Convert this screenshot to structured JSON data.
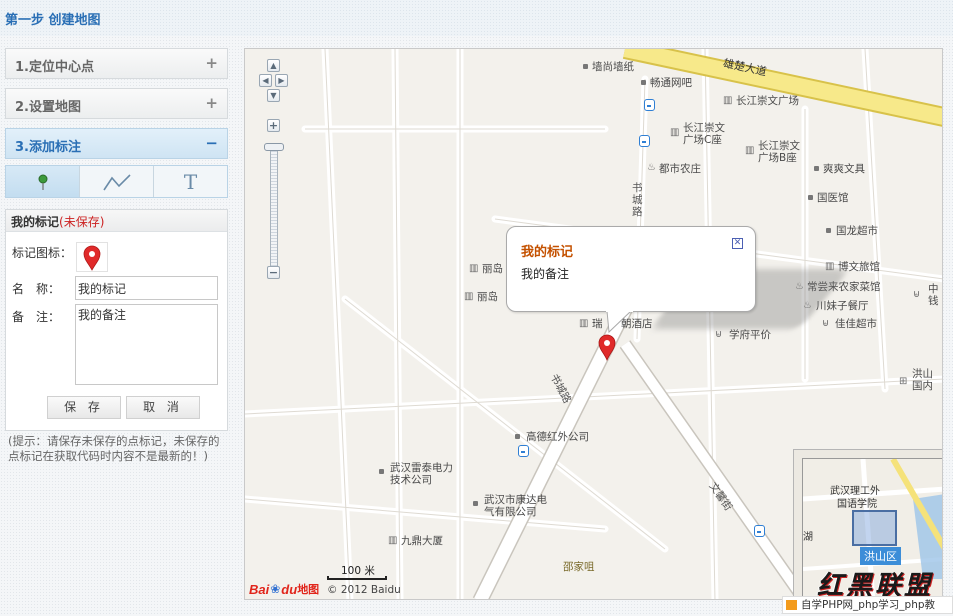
{
  "header": {
    "title": "第一步 创建地图"
  },
  "steps": [
    {
      "label": "1.定位中心点",
      "toggle": "+"
    },
    {
      "label": "2.设置地图",
      "toggle": "+"
    },
    {
      "label": "3.添加标注",
      "toggle": "−"
    }
  ],
  "tools": {
    "text_tool": "T",
    "icons": [
      "pin-icon",
      "polyline-icon",
      "text-icon"
    ]
  },
  "marker_panel": {
    "title": "我的标记",
    "unsaved": "(未保存)",
    "icon_label": "标记图标：",
    "name_label": "名　称：",
    "name_value": "我的标记",
    "note_label": "备　注：",
    "note_value": "我的备注",
    "save_label": "保 存",
    "cancel_label": "取 消"
  },
  "hint": "(提示：请保存未保存的点标记，未保存的点标记在获取代码时内容不是最新的！)",
  "map": {
    "info_window": {
      "title": "我的标记",
      "body": "我的备注"
    },
    "roads": {
      "xiongchu": "雄楚大道",
      "shucheng1": "书城路",
      "shucheng2": "书城路",
      "wenxin": "文馨街"
    },
    "pois": {
      "qiangshang": "墙尚墙纸",
      "changxiang": "畅通网吧",
      "cjwg": "长江崇文广场",
      "cjc": "长江崇文广场C座",
      "cjb": "长江崇文广场B座",
      "dushi": "都市农庄",
      "shuangshuang": "爽爽文具",
      "guoyi": "国医馆",
      "guolong": "国龙超市",
      "bowen": "博文旅馆",
      "changchang": "常尝来农家菜馆",
      "chuanmei": "川妹子餐厅",
      "jiajia": "佳佳超市",
      "zhong": "中",
      "qian": "钱",
      "xuefu": "学府平价",
      "ruidian": "瑞",
      "chaojiudian": "朝酒店",
      "lidao1": "丽岛",
      "lidao2": "丽岛",
      "gaode": "高德红外公司",
      "leitai": "武汉雷泰电力技术公司",
      "kangda": "武汉市康达电气有限公司",
      "jiuding": "九鼎大厦",
      "shaojia": "邵家咀",
      "hongshan": "洪山",
      "guonei": "国内"
    },
    "scale": "100 米",
    "copyright": "© 2012 Baidu",
    "logo": {
      "bai": "Bai",
      "du": "du",
      "ditu": "地图"
    },
    "overview": {
      "label1": "武汉理工外",
      "label2": "国语学院",
      "label3": "湖",
      "badge": "洪山区"
    }
  },
  "watermark": {
    "text": "红黑联盟",
    "bar": "自学PHP网_php学习_php教"
  },
  "colors": {
    "accent": "#2a6fb5",
    "road_major": "#f5e27a",
    "marker": "#e02a2a",
    "unsaved": "#cc2222"
  }
}
